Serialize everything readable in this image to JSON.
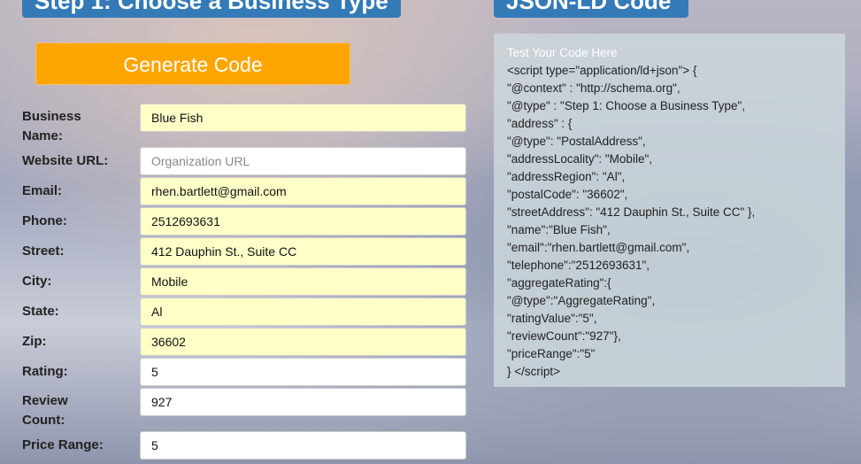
{
  "headers": {
    "left": "Step 1: Choose a Business Type",
    "right": "JSON-LD Code"
  },
  "generate_label": "Generate Code",
  "fields": [
    {
      "label": "Business Name:",
      "value": "Blue Fish",
      "placeholder": "",
      "filled": true
    },
    {
      "label": "Website URL:",
      "value": "",
      "placeholder": "Organization URL",
      "filled": false
    },
    {
      "label": "Email:",
      "value": "rhen.bartlett@gmail.com",
      "placeholder": "",
      "filled": true
    },
    {
      "label": "Phone:",
      "value": "2512693631",
      "placeholder": "",
      "filled": true
    },
    {
      "label": "Street:",
      "value": "412 Dauphin St., Suite CC",
      "placeholder": "",
      "filled": true
    },
    {
      "label": "City:",
      "value": "Mobile",
      "placeholder": "",
      "filled": true
    },
    {
      "label": "State:",
      "value": "Al",
      "placeholder": "",
      "filled": true
    },
    {
      "label": "Zip:",
      "value": "36602",
      "placeholder": "",
      "filled": true
    },
    {
      "label": "Rating:",
      "value": "5",
      "placeholder": "",
      "filled": false
    },
    {
      "label": "Review Count:",
      "value": "927",
      "placeholder": "",
      "filled": false
    },
    {
      "label": "Price Range:",
      "value": "5",
      "placeholder": "",
      "filled": false
    }
  ],
  "code": {
    "title": "Test Your Code Here",
    "lines": [
      "<script type=\"application/ld+json\"> {",
      "\"@context\" : \"http://schema.org\",",
      "\"@type\" : \"Step 1: Choose a Business Type\",",
      "\"address\" : {",
      "\"@type\": \"PostalAddress\",",
      "\"addressLocality\": \"Mobile\",",
      "\"addressRegion\": \"Al\",",
      "\"postalCode\": \"36602\",",
      "\"streetAddress\": \"412 Dauphin St., Suite CC\" },",
      "\"name\":\"Blue Fish\",",
      "\"email\":\"rhen.bartlett@gmail.com\",",
      "\"telephone\":\"2512693631\",",
      "\"aggregateRating\":{",
      "\"@type\":\"AggregateRating\",",
      "\"ratingValue\":\"5\",",
      "\"reviewCount\":\"927\"},",
      "\"priceRange\":\"5\"",
      "} </script>"
    ]
  }
}
